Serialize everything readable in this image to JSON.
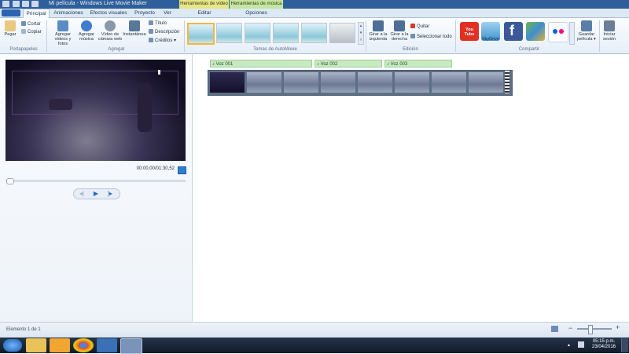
{
  "window": {
    "title": "Mi película - Windows Live Movie Maker"
  },
  "context_tabs": {
    "video_tools": "Herramientas de vídeo",
    "music_tools": "Herramientas de música"
  },
  "tabs": [
    {
      "label": "Principal"
    },
    {
      "label": "Animaciones"
    },
    {
      "label": "Efectos visuales"
    },
    {
      "label": "Proyecto"
    },
    {
      "label": "Ver"
    },
    {
      "label": "Editar"
    },
    {
      "label": "Opciones"
    }
  ],
  "ribbon": {
    "clipboard": {
      "paste": "Pegar",
      "cut": "Cortar",
      "copy": "Copiar",
      "group": "Portapapeles"
    },
    "add": {
      "add_videos": "Agregar vídeos y fotos",
      "add_music": "Agregar música",
      "webcam": "Vídeo de cámara web",
      "snapshot": "Instantánea",
      "title": "Título",
      "caption": "Descripción",
      "credits": "Créditos",
      "group": "Agregar"
    },
    "themes": {
      "group": "Temas de AutoMovie"
    },
    "editing": {
      "rotate_left": "Girar a la izquierda",
      "rotate_right": "Girar a la derecha",
      "remove": "Quitar",
      "select_all": "Seleccionar todo",
      "group": "Edición"
    },
    "share": {
      "youtube": "You Tube",
      "skydrive": "SkyDrive",
      "save_movie": "Guardar película",
      "group": "Compartir"
    },
    "signin": "Iniciar sesión"
  },
  "player": {
    "timecode": "00:00,00/01:30,52",
    "position_fraction": 0.0
  },
  "storyboard": {
    "voices": [
      "Voz 001",
      "Voz 002",
      "Voz 003"
    ]
  },
  "status": {
    "text": "Elemento 1 de 1",
    "zoom_fraction": 0.35
  },
  "taskbar": {
    "time": "05:15 p.m.",
    "date": "23/04/2016"
  }
}
